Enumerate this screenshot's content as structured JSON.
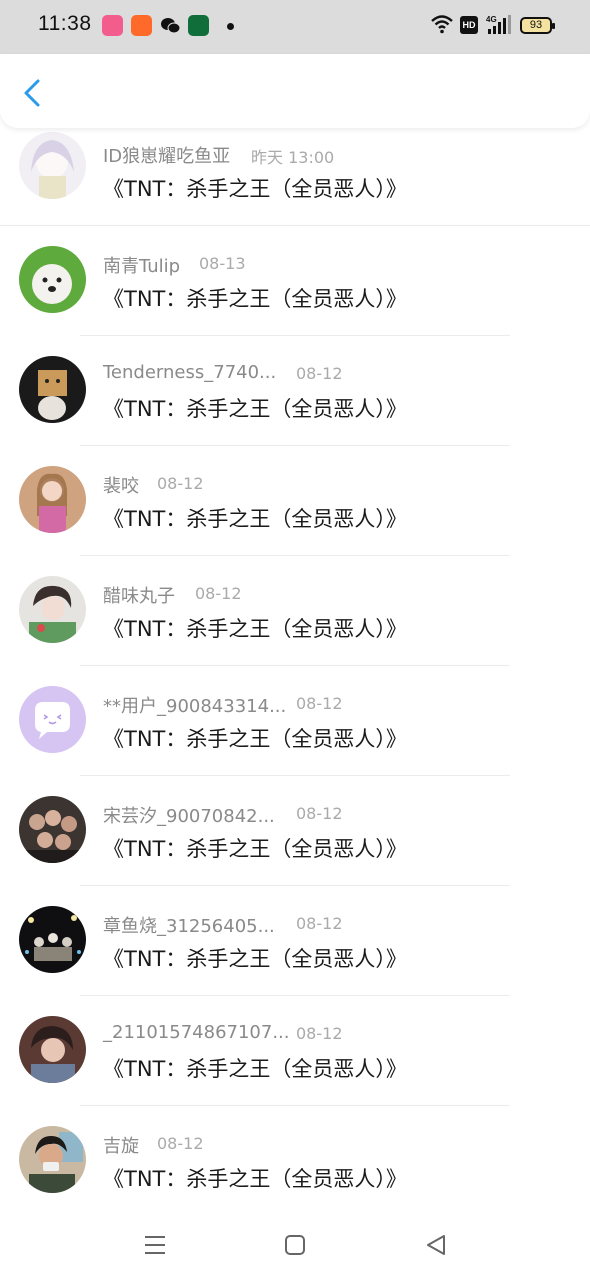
{
  "status_bar": {
    "time": "11:38",
    "battery": "93",
    "hd_label": "HD",
    "network_label": "4G"
  },
  "header": {
    "back_icon": "chevron-left-icon",
    "accent_color": "#2a9bea"
  },
  "messages": [
    {
      "user": "ID狼崽耀吃鱼亚",
      "date": "昨天 13:00",
      "title": "《TNT：杀手之王（全员恶人）》"
    },
    {
      "user": "南青Tulip",
      "date": "08-13",
      "title": "《TNT：杀手之王（全员恶人）》"
    },
    {
      "user": "Tenderness_7740...",
      "date": "08-12",
      "title": "《TNT：杀手之王（全员恶人）》"
    },
    {
      "user": "裴咬",
      "date": "08-12",
      "title": "《TNT：杀手之王（全员恶人）》"
    },
    {
      "user": "醋味丸子",
      "date": "08-12",
      "title": "《TNT：杀手之王（全员恶人）》"
    },
    {
      "user": "**用户_900843314...",
      "date": "08-12",
      "title": "《TNT：杀手之王（全员恶人）》"
    },
    {
      "user": "宋芸汐_90070842...",
      "date": "08-12",
      "title": "《TNT：杀手之王（全员恶人）》"
    },
    {
      "user": "章鱼烧_31256405...",
      "date": "08-12",
      "title": "《TNT：杀手之王（全员恶人）》"
    },
    {
      "user": "_21101574867107...",
      "date": "08-12",
      "title": "《TNT：杀手之王（全员恶人）》"
    },
    {
      "user": "吉旋",
      "date": "08-12",
      "title": "《TNT：杀手之王（全员恶人）》"
    }
  ],
  "nav_bar": {
    "menu_icon": "menu-icon",
    "home_icon": "home-square-icon",
    "back_icon": "back-triangle-icon"
  }
}
